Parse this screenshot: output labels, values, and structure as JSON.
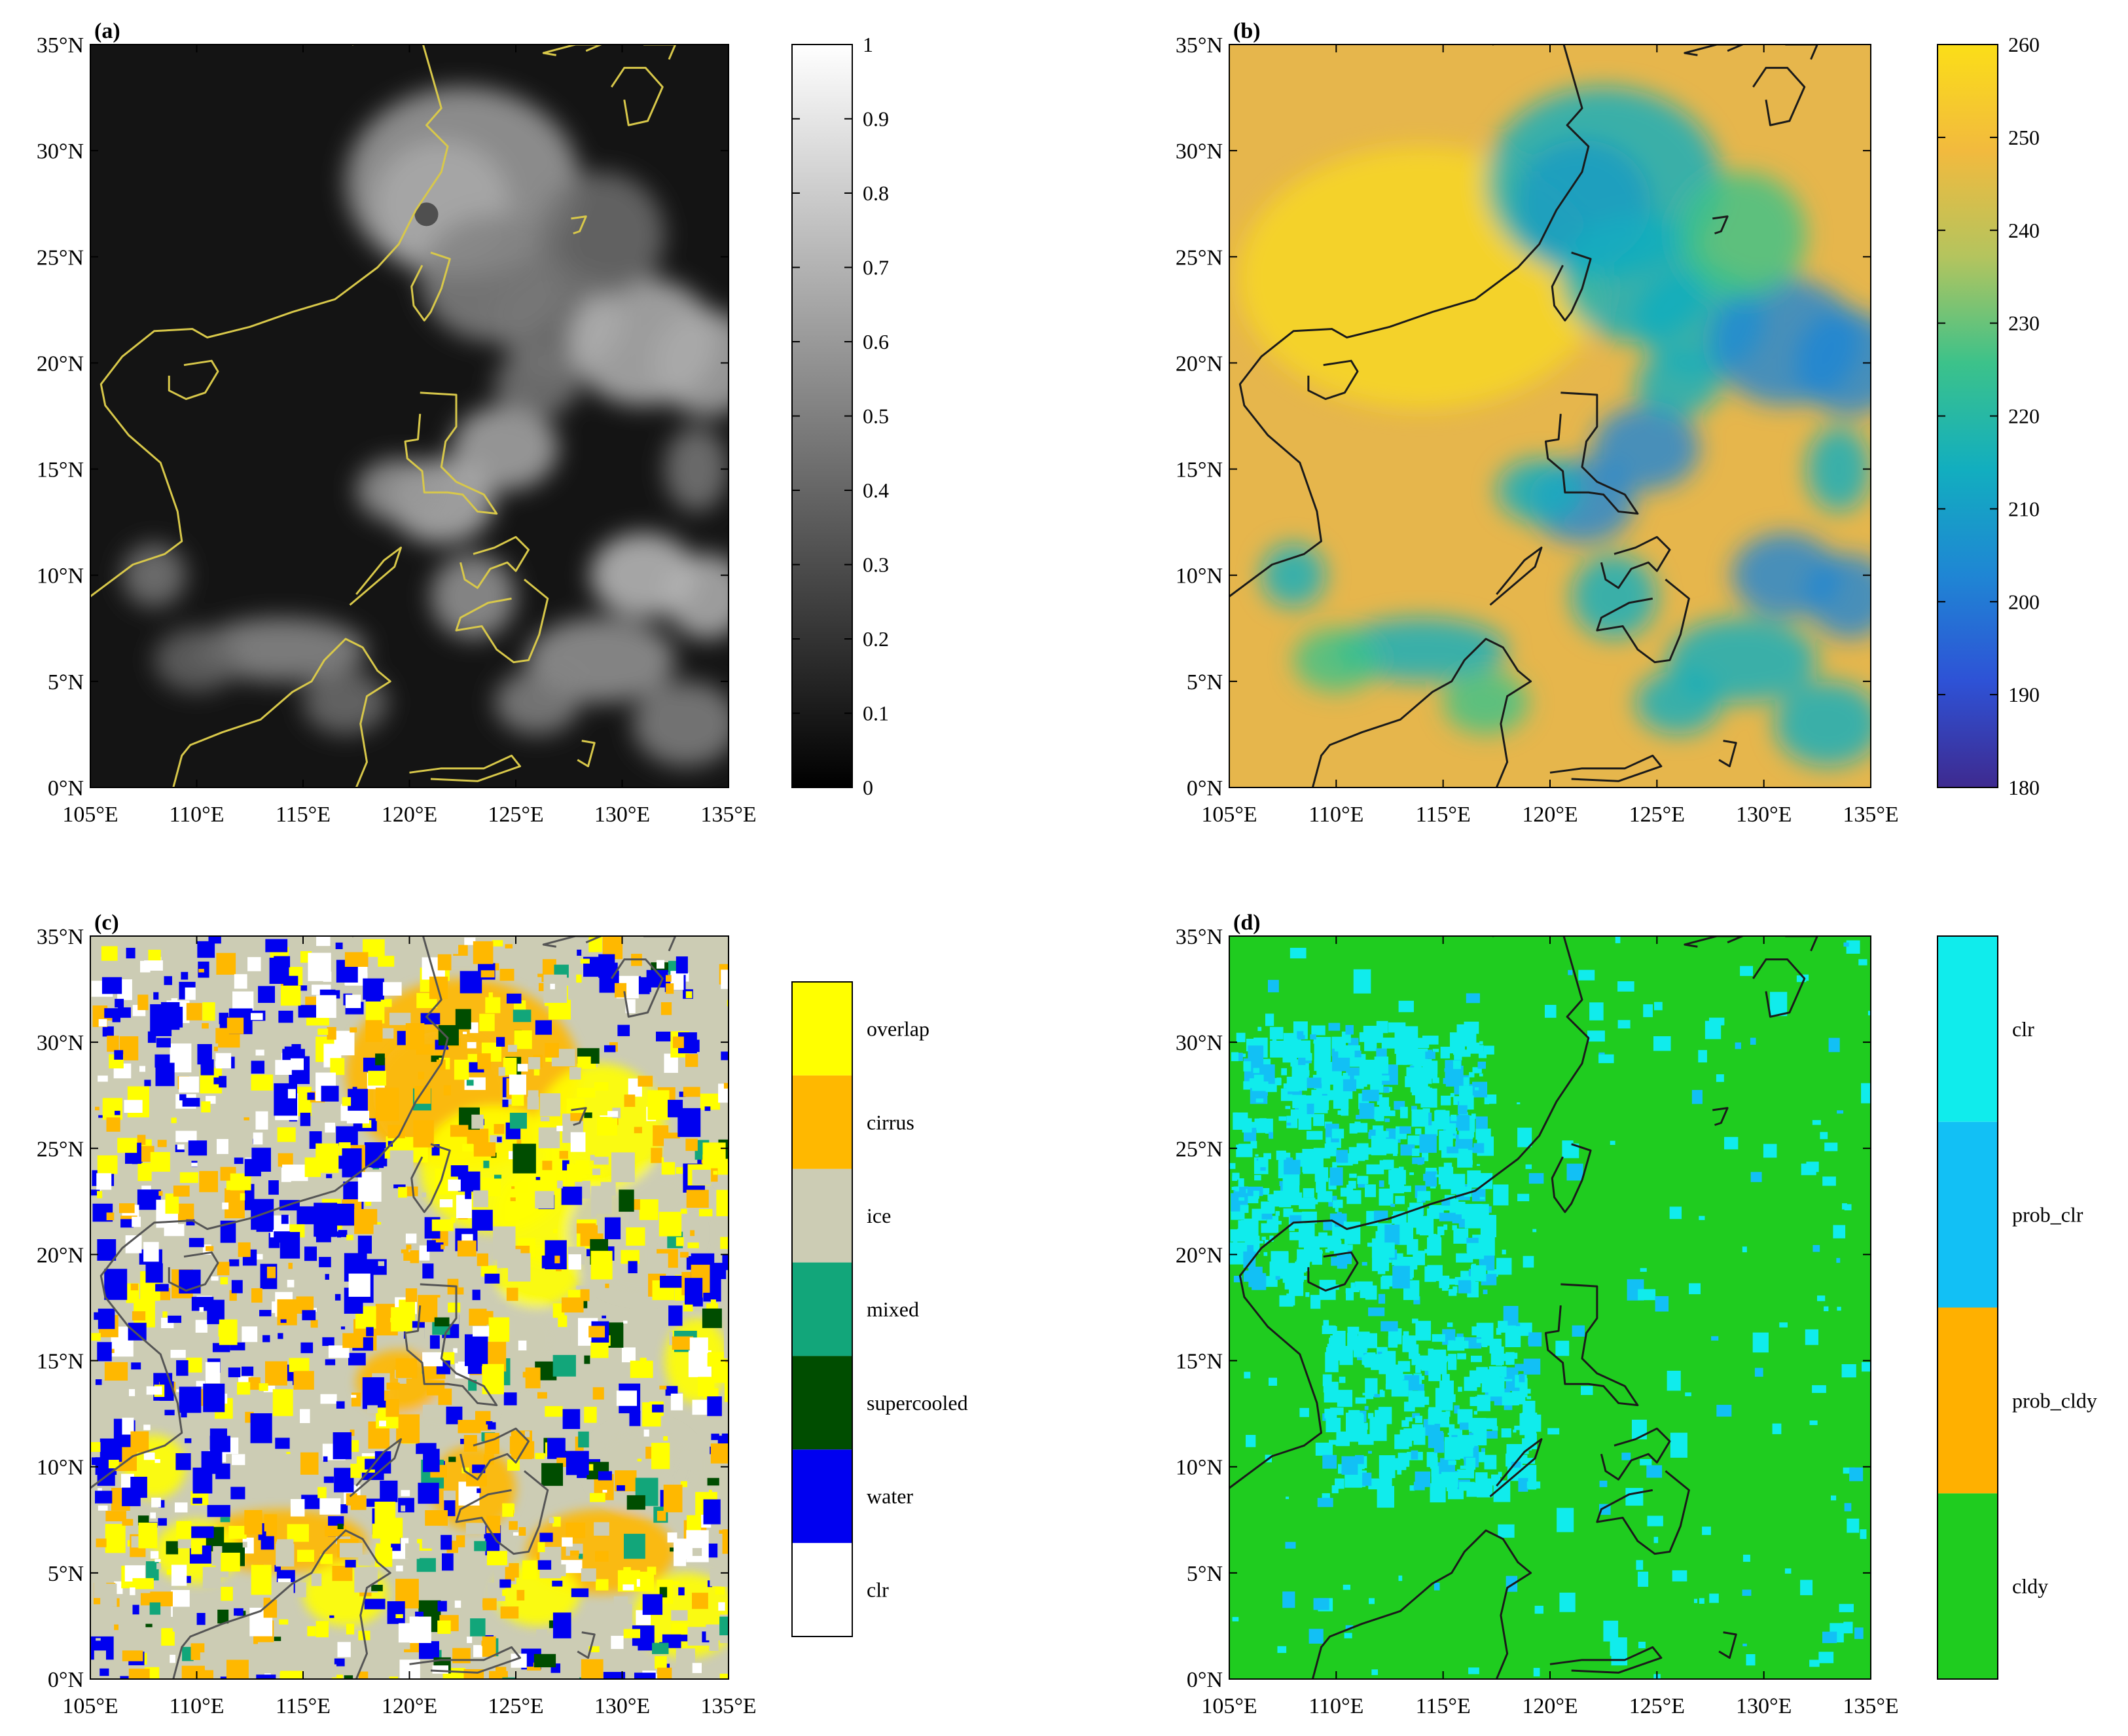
{
  "chart_data": [
    {
      "type": "heatmap",
      "panel_label": "(a)",
      "xlim": [
        105,
        135
      ],
      "ylim": [
        0,
        35
      ],
      "x_ticks": [
        "105°E",
        "110°E",
        "115°E",
        "120°E",
        "125°E",
        "130°E",
        "135°E"
      ],
      "y_ticks": [
        "0°N",
        "5°N",
        "10°N",
        "15°N",
        "20°N",
        "25°N",
        "30°N",
        "35°N"
      ],
      "colorbar": {
        "kind": "continuous",
        "range": [
          0,
          1
        ],
        "colors": [
          "#000000",
          "#ffffff"
        ],
        "ticks": [
          "0",
          "0.1",
          "0.2",
          "0.3",
          "0.4",
          "0.5",
          "0.6",
          "0.7",
          "0.8",
          "0.9",
          "1"
        ]
      },
      "coastline_color": "#d8c84a",
      "background_color": "#141414"
    },
    {
      "type": "heatmap",
      "panel_label": "(b)",
      "xlim": [
        105,
        135
      ],
      "ylim": [
        0,
        35
      ],
      "x_ticks": [
        "105°E",
        "110°E",
        "115°E",
        "120°E",
        "125°E",
        "130°E",
        "135°E"
      ],
      "y_ticks": [
        "0°N",
        "5°N",
        "10°N",
        "15°N",
        "20°N",
        "25°N",
        "30°N",
        "35°N"
      ],
      "colorbar": {
        "kind": "continuous",
        "range": [
          180,
          260
        ],
        "colors": [
          "#3e2a8f",
          "#2e52d6",
          "#1f86d4",
          "#12aebf",
          "#3cc28a",
          "#b4c45e",
          "#f2ba3e",
          "#fbde18"
        ],
        "ticks": [
          "180",
          "190",
          "200",
          "210",
          "220",
          "230",
          "240",
          "250",
          "260"
        ]
      },
      "coastline_color": "#1a1a1a",
      "background_color": "#e6b64c"
    },
    {
      "type": "heatmap",
      "panel_label": "(c)",
      "xlim": [
        105,
        135
      ],
      "ylim": [
        0,
        35
      ],
      "x_ticks": [
        "105°E",
        "110°E",
        "115°E",
        "120°E",
        "125°E",
        "130°E",
        "135°E"
      ],
      "y_ticks": [
        "0°N",
        "5°N",
        "10°N",
        "15°N",
        "20°N",
        "25°N",
        "30°N",
        "35°N"
      ],
      "colorbar": {
        "kind": "categorical",
        "categories": [
          "clr",
          "water",
          "supercooled",
          "mixed",
          "ice",
          "cirrus",
          "overlap"
        ],
        "colors": [
          "#ffffff",
          "#0000f0",
          "#004d00",
          "#12a67a",
          "#ccccb4",
          "#ffb800",
          "#ffff00"
        ]
      },
      "coastline_color": "#555555",
      "background_color": "#ccccb4"
    },
    {
      "type": "heatmap",
      "panel_label": "(d)",
      "xlim": [
        105,
        135
      ],
      "ylim": [
        0,
        35
      ],
      "x_ticks": [
        "105°E",
        "110°E",
        "115°E",
        "120°E",
        "125°E",
        "130°E",
        "135°E"
      ],
      "y_ticks": [
        "0°N",
        "5°N",
        "10°N",
        "15°N",
        "20°N",
        "25°N",
        "30°N",
        "35°N"
      ],
      "colorbar": {
        "kind": "categorical",
        "categories": [
          "cldy",
          "prob_cldy",
          "prob_clr",
          "clr"
        ],
        "colors": [
          "#1fcc1f",
          "#ffb000",
          "#12c0f5",
          "#10ecec"
        ]
      },
      "coastline_color": "#1a1a1a",
      "background_color": "#1fcc1f"
    }
  ]
}
